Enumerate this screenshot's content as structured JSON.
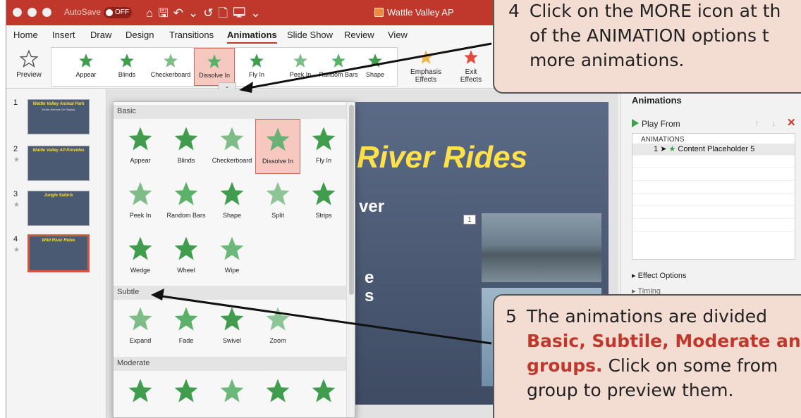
{
  "window": {
    "autosave_label": "AutoSave",
    "autosave_state": "OFF",
    "doc_title": "Wattle Valley AP"
  },
  "tabs": [
    "Home",
    "Insert",
    "Draw",
    "Design",
    "Transitions",
    "Animations",
    "Slide Show",
    "Review",
    "View"
  ],
  "active_tab": "Animations",
  "ribbon": {
    "preview_label": "Preview",
    "gallery": [
      "Appear",
      "Blinds",
      "Checkerboard",
      "Dissolve In",
      "Fly In",
      "Peek In",
      "Random Bars",
      "Shape"
    ],
    "selected": "Dissolve In",
    "emphasis_label": "Emphasis\nEffects",
    "exit_label": "Exit\nEffects"
  },
  "slides": [
    {
      "num": "1",
      "title": "Wattle Valley Animal Park",
      "body": "Exotic Animals On Display",
      "has_anim": false
    },
    {
      "num": "2",
      "title": "Wattle Valley AP Provides",
      "body": "",
      "has_anim": true
    },
    {
      "num": "3",
      "title": "Jungle Safaris",
      "body": "",
      "has_anim": true
    },
    {
      "num": "4",
      "title": "Wild River Rides",
      "body": "",
      "has_anim": true
    }
  ],
  "slide": {
    "title": "River Rides",
    "text1": "ver",
    "text2": "e",
    "text3": "s",
    "anim_badge": "1"
  },
  "anim_pane": {
    "title": "Animations",
    "play_from": "Play From",
    "list_header": "ANIMATIONS",
    "item_num": "1",
    "item_label": "Content Placeholder 5",
    "effect_options": "Effect Options",
    "timing": "Timing"
  },
  "dropdown": {
    "sections": [
      {
        "name": "Basic",
        "items": [
          "Appear",
          "Blinds",
          "Checkerboard",
          "Dissolve In",
          "Fly In",
          "Peek In",
          "Random Bars",
          "Shape",
          "Split",
          "Strips",
          "Wedge",
          "Wheel",
          "Wipe"
        ]
      },
      {
        "name": "Subtle",
        "items": [
          "Expand",
          "Fade",
          "Swivel",
          "Zoom"
        ]
      },
      {
        "name": "Moderate",
        "items": [
          "",
          "",
          "",
          "",
          ""
        ]
      }
    ],
    "selected": "Dissolve In"
  },
  "callouts": {
    "c4_num": "4",
    "c4_line1": "Click on the MORE icon at th",
    "c4_line2": "of the ANIMATION options t",
    "c4_line3": "more animations.",
    "c5_num": "5",
    "c5_line1": "The animations are divided",
    "c5_line2a": "Basic, Subtile, Moderate and",
    "c5_line3a": "groups.",
    "c5_line3b": "Click on some from",
    "c5_line4": "group to preview them."
  },
  "colors": {
    "titlebar": "#c0382b",
    "star": "#3f9d4d",
    "selection": "#f6c8c0",
    "slide_title": "#ffe14a"
  }
}
